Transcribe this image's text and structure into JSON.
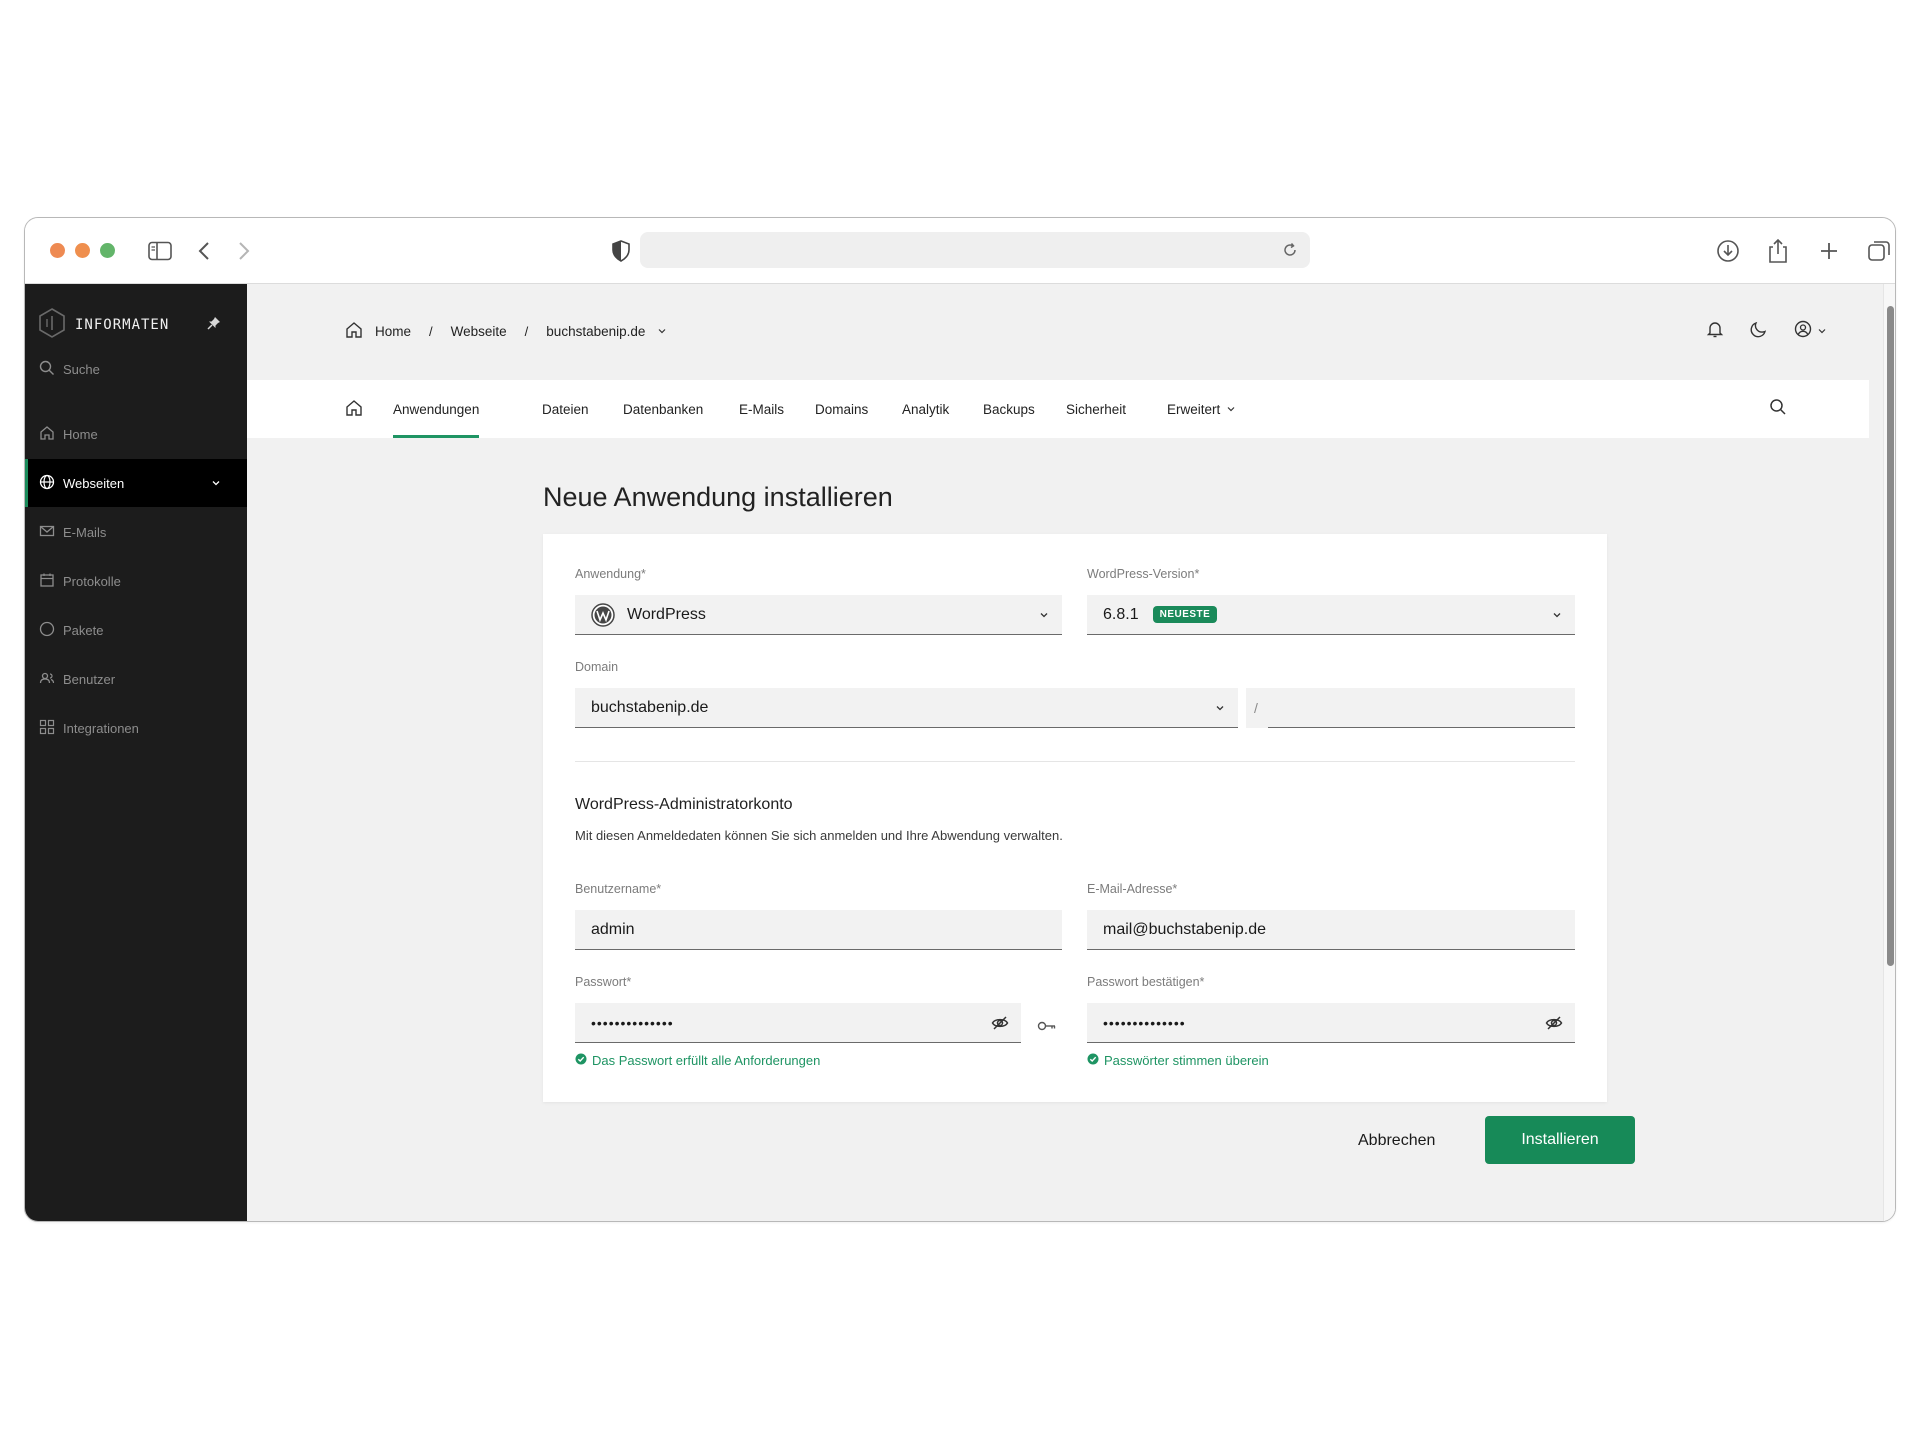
{
  "sidebar": {
    "brand": "INFORMATEN",
    "search_placeholder": "Suche",
    "items": [
      {
        "label": "Home",
        "icon": "home-icon"
      },
      {
        "label": "Webseiten",
        "icon": "globe-icon",
        "active": true
      },
      {
        "label": "E-Mails",
        "icon": "mail-icon"
      },
      {
        "label": "Protokolle",
        "icon": "calendar-icon"
      },
      {
        "label": "Pakete",
        "icon": "circle-icon"
      },
      {
        "label": "Benutzer",
        "icon": "users-icon"
      },
      {
        "label": "Integrationen",
        "icon": "grid-icon"
      }
    ]
  },
  "breadcrumb": {
    "home": "Home",
    "section": "Webseite",
    "domain": "buchstabenip.de"
  },
  "tabs": [
    "Anwendungen",
    "Dateien",
    "Datenbanken",
    "E-Mails",
    "Domains",
    "Analytik",
    "Backups",
    "Sicherheit",
    "Erweitert"
  ],
  "page": {
    "title": "Neue Anwendung installieren"
  },
  "form": {
    "application_label": "Anwendung*",
    "application_value": "WordPress",
    "version_label": "WordPress-Version*",
    "version_value": "6.8.1",
    "version_badge": "NEUESTE",
    "domain_label": "Domain",
    "domain_value": "buchstabenip.de",
    "path_prefix": "/",
    "admin_section_title": "WordPress-Administratorkonto",
    "admin_section_desc": "Mit diesen Anmeldedaten können Sie sich anmelden und Ihre Abwendung verwalten.",
    "username_label": "Benutzername*",
    "username_value": "admin",
    "email_label": "E-Mail-Adresse*",
    "email_value": "mail@buchstabenip.de",
    "password_label": "Passwort*",
    "password_value": "••••••••••••••",
    "password_confirm_label": "Passwort bestätigen*",
    "password_confirm_value": "••••••••••••••",
    "password_hint": "Das Passwort erfüllt alle Anforderungen",
    "password_match_hint": "Passwörter stimmen überein"
  },
  "actions": {
    "cancel": "Abbrechen",
    "install": "Installieren"
  },
  "colors": {
    "accent": "#178a58",
    "sidebar_bg": "#1c1c1c",
    "success": "#1e9463"
  }
}
